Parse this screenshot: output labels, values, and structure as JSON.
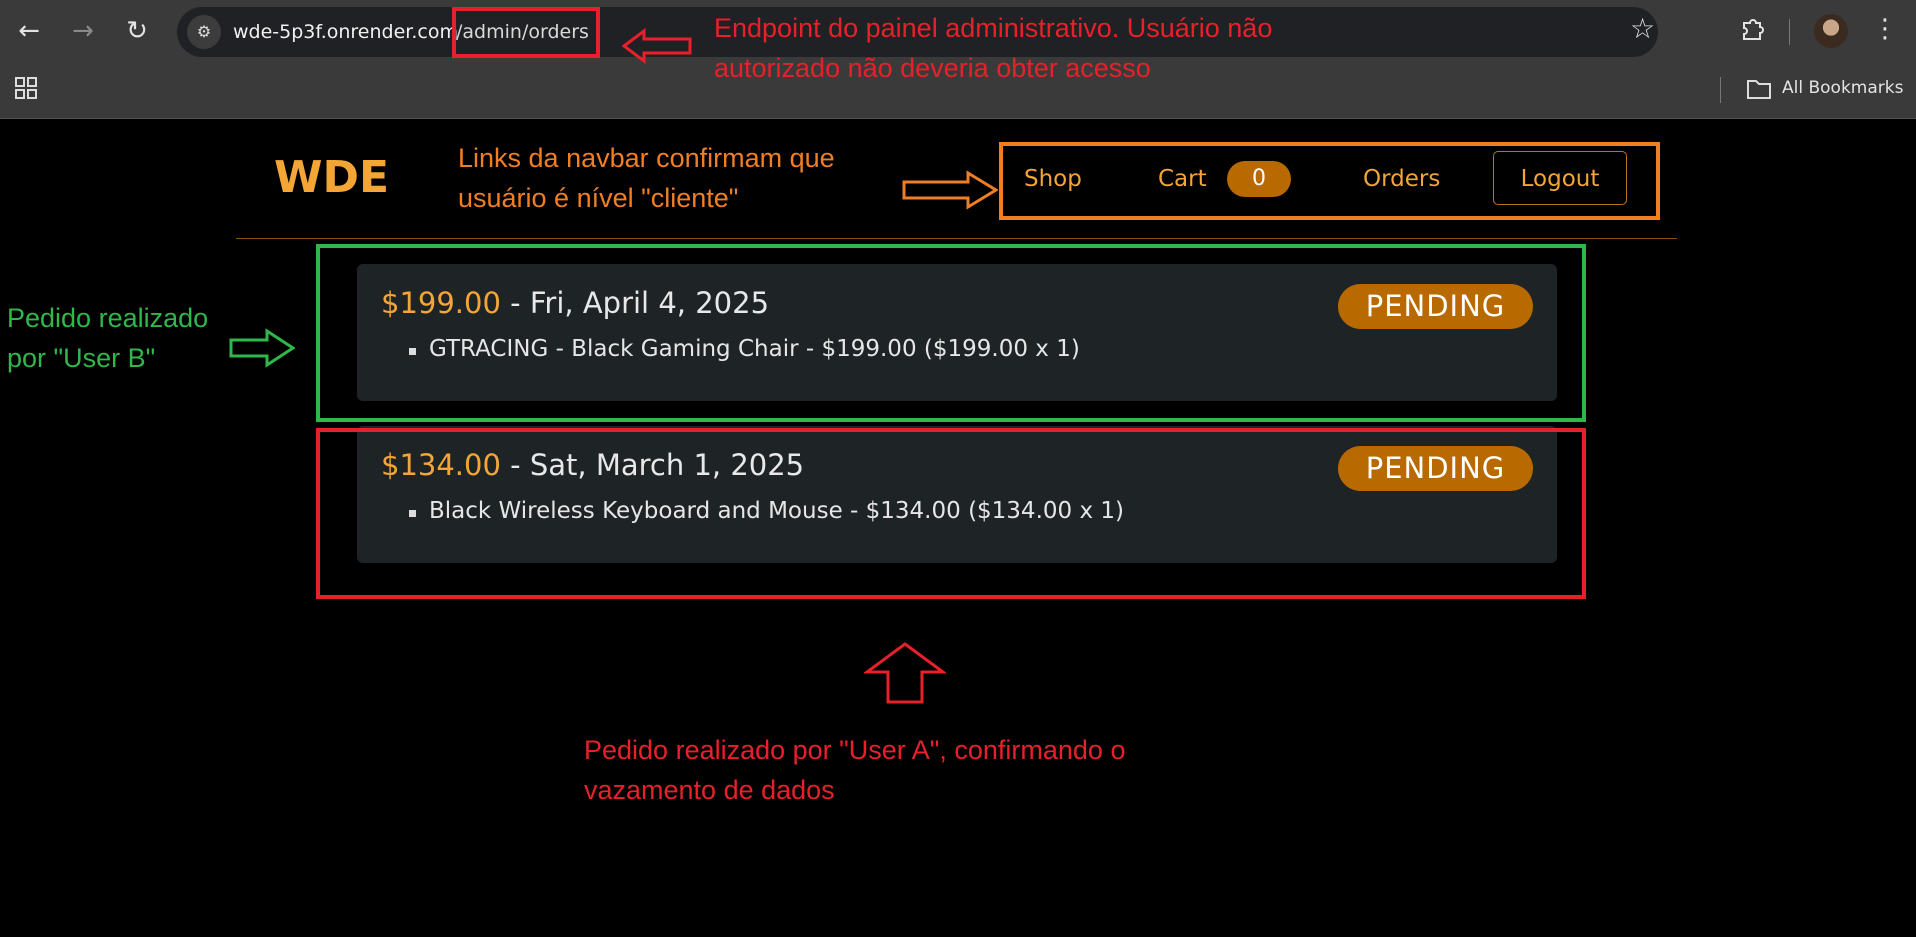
{
  "browser": {
    "url_host": "wde-5p3f.onrender.com",
    "url_path": "/admin/orders",
    "bookmarks_label": "All Bookmarks"
  },
  "site": {
    "brand": "WDE",
    "nav": {
      "shop": "Shop",
      "cart": "Cart",
      "cart_count": "0",
      "orders": "Orders",
      "logout": "Logout"
    }
  },
  "orders": [
    {
      "price": "$199.00",
      "date": " - Fri, April 4, 2025",
      "status": "PENDING",
      "item": "GTRACING - Black Gaming Chair - $199.00 ($199.00 x 1)"
    },
    {
      "price": "$134.00",
      "date": " - Sat, March 1, 2025",
      "status": "PENDING",
      "item": "Black Wireless Keyboard and Mouse - $134.00 ($134.00 x 1)"
    }
  ],
  "annotations": {
    "endpoint_line1": "Endpoint do painel administrativo. Usuário não",
    "endpoint_line2": "autorizado não deveria obter acesso",
    "navbar_line1": "Links da navbar confirmam que",
    "navbar_line2": "usuário é nível \"cliente\"",
    "user_b_line1": "Pedido realizado",
    "user_b_line2": "por \"User B\"",
    "user_a_line1": "Pedido realizado por \"User A\", confirmando o",
    "user_a_line2": "vazamento de dados"
  },
  "colors": {
    "accent": "#f3a536",
    "badge": "#b86a00",
    "annotation_red": "#e8202a",
    "annotation_orange": "#f07f24",
    "annotation_green": "#2fb84a"
  }
}
